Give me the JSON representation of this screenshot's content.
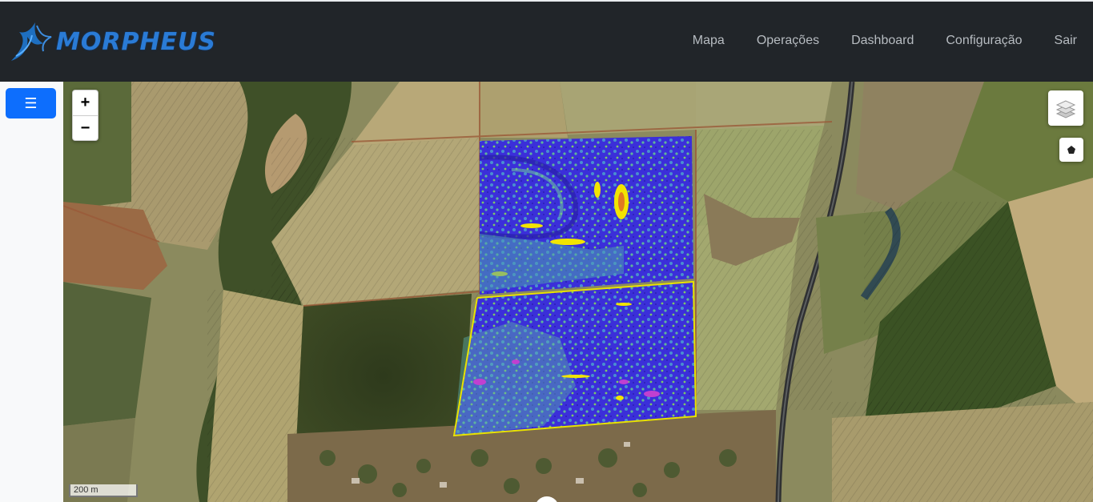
{
  "brand": {
    "name": "MORPHEUS",
    "logo_icon": "phoenix-logo-icon"
  },
  "nav": {
    "links": [
      {
        "label": "Mapa"
      },
      {
        "label": "Operações"
      },
      {
        "label": "Dashboard"
      },
      {
        "label": "Configuração"
      },
      {
        "label": "Sair"
      }
    ]
  },
  "sidebar": {
    "menu_icon": "☰"
  },
  "map": {
    "zoom_in": "+",
    "zoom_out": "−",
    "scale_label": "200 m",
    "layers_icon": "layers-icon",
    "draw_polygon_icon": "pentagon-icon"
  },
  "colors": {
    "navbar": "#212529",
    "nav_text": "#b7bcc1",
    "primary": "#0d6efd",
    "ndvi_low": "#3a2bd6",
    "ndvi_mid": "#4fa8a0",
    "ndvi_high": "#f2e400"
  }
}
